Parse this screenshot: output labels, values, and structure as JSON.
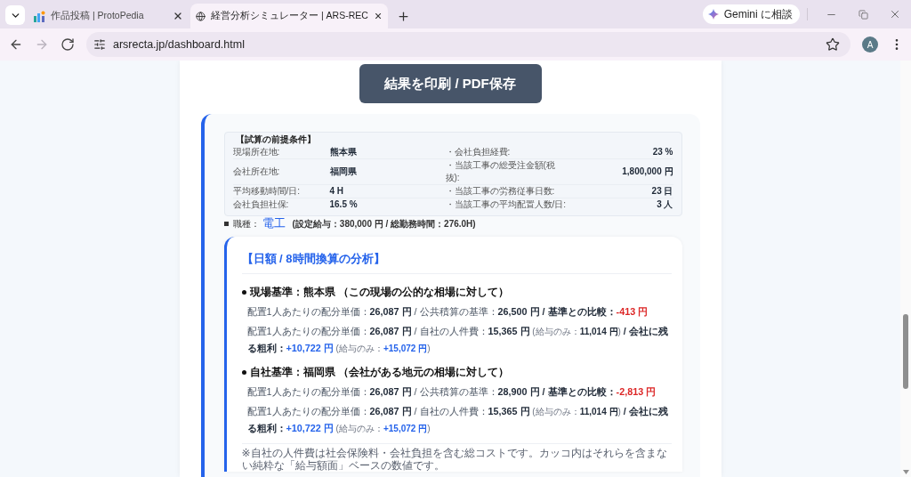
{
  "browser": {
    "tabs": [
      {
        "kind": "protopedia",
        "title": "作品投稿 | ProtoPedia",
        "selected": false
      },
      {
        "kind": "globe",
        "title": "経営分析シミュレーター | ARS-REC",
        "selected": true
      }
    ],
    "gemini_button": "Gemini に相談"
  },
  "toolbar": {
    "back_disabled": false,
    "forward_disabled": true,
    "url": "arsrecta.jp/dashboard.html",
    "profile_initial": "A"
  },
  "page": {
    "print_button": "結果を印刷 / PDF保存",
    "conditions": {
      "title": "【試算の前提条件】",
      "rows": [
        {
          "label": "現場所在地:",
          "value": "熊本県",
          "label_2": "・会社負担経費:",
          "value_2": "23 %"
        },
        {
          "label": "会社所在地:",
          "value": "福岡県",
          "label_2": "・当該工事の総受注金額(税抜):",
          "value_2": "1,800,000 円"
        },
        {
          "label": "平均移動時間/日:",
          "value": "4 H",
          "label_2": "・当該工事の労務従事日数:",
          "value_2": "23 日"
        },
        {
          "label": "会社負担社保:",
          "value": "16.5 %",
          "label_2": "・当該工事の平均配置人数/日:",
          "value_2": "3 人"
        }
      ]
    },
    "job": {
      "label": "職種：",
      "value": "電工",
      "detail": "(設定給与：380,000 円 / 総勤務時間：276.0H)"
    },
    "analysis": {
      "title": "【日額 / 8時間換算の分析】",
      "sections": [
        {
          "heading": "現場基準：熊本県 （この現場の公的な相場に対して）",
          "lines": [
            {
              "segments": [
                {
                  "kind": "label",
                  "text": "配置1人あたりの配分単価："
                },
                {
                  "kind": "value",
                  "text": "26,087 円"
                },
                {
                  "kind": "label",
                  "text": " / 公共積算の基準："
                },
                {
                  "kind": "value",
                  "text": "26,500 円"
                },
                {
                  "kind": "value",
                  "text": " / 基準との比較："
                },
                {
                  "kind": "negative",
                  "text": "-413 円"
                }
              ]
            },
            {
              "segments": [
                {
                  "kind": "label",
                  "text": "配置1人あたりの配分単価："
                },
                {
                  "kind": "value",
                  "text": "26,087 円"
                },
                {
                  "kind": "label",
                  "text": " / 自社の人件費："
                },
                {
                  "kind": "value",
                  "text": "15,365 円"
                },
                {
                  "kind": "note",
                  "text": " (給与のみ："
                },
                {
                  "kind": "note_value",
                  "text": "11,014 円"
                },
                {
                  "kind": "note",
                  "text": ")"
                },
                {
                  "kind": "value",
                  "text": " / 会社に残る粗利："
                },
                {
                  "kind": "positive",
                  "text": "+10,722 円"
                },
                {
                  "kind": "note",
                  "text": " (給与のみ："
                },
                {
                  "kind": "note_positive",
                  "text": "+15,072 円"
                },
                {
                  "kind": "note",
                  "text": ")"
                }
              ]
            }
          ]
        },
        {
          "heading": "自社基準：福岡県 （会社がある地元の相場に対して）",
          "lines": [
            {
              "segments": [
                {
                  "kind": "label",
                  "text": "配置1人あたりの配分単価："
                },
                {
                  "kind": "value",
                  "text": "26,087 円"
                },
                {
                  "kind": "label",
                  "text": " / 公共積算の基準："
                },
                {
                  "kind": "value",
                  "text": "28,900 円"
                },
                {
                  "kind": "value",
                  "text": " / 基準との比較："
                },
                {
                  "kind": "negative",
                  "text": "-2,813 円"
                }
              ]
            },
            {
              "segments": [
                {
                  "kind": "label",
                  "text": "配置1人あたりの配分単価："
                },
                {
                  "kind": "value",
                  "text": "26,087 円"
                },
                {
                  "kind": "label",
                  "text": " / 自社の人件費："
                },
                {
                  "kind": "value",
                  "text": "15,365 円"
                },
                {
                  "kind": "note",
                  "text": " (給与のみ："
                },
                {
                  "kind": "note_value",
                  "text": "11,014 円"
                },
                {
                  "kind": "note",
                  "text": ")"
                },
                {
                  "kind": "value",
                  "text": " / 会社に残る粗利："
                },
                {
                  "kind": "positive",
                  "text": "+10,722 円"
                },
                {
                  "kind": "note",
                  "text": " (給与のみ："
                },
                {
                  "kind": "note_positive",
                  "text": "+15,072 円"
                },
                {
                  "kind": "note",
                  "text": ")"
                }
              ]
            }
          ]
        }
      ],
      "note": "※自社の人件費は社会保険料・会社負担を含む総コストです。カッコ内はそれらを含まない純粋な「給与額面」ベースの数値です。"
    }
  }
}
